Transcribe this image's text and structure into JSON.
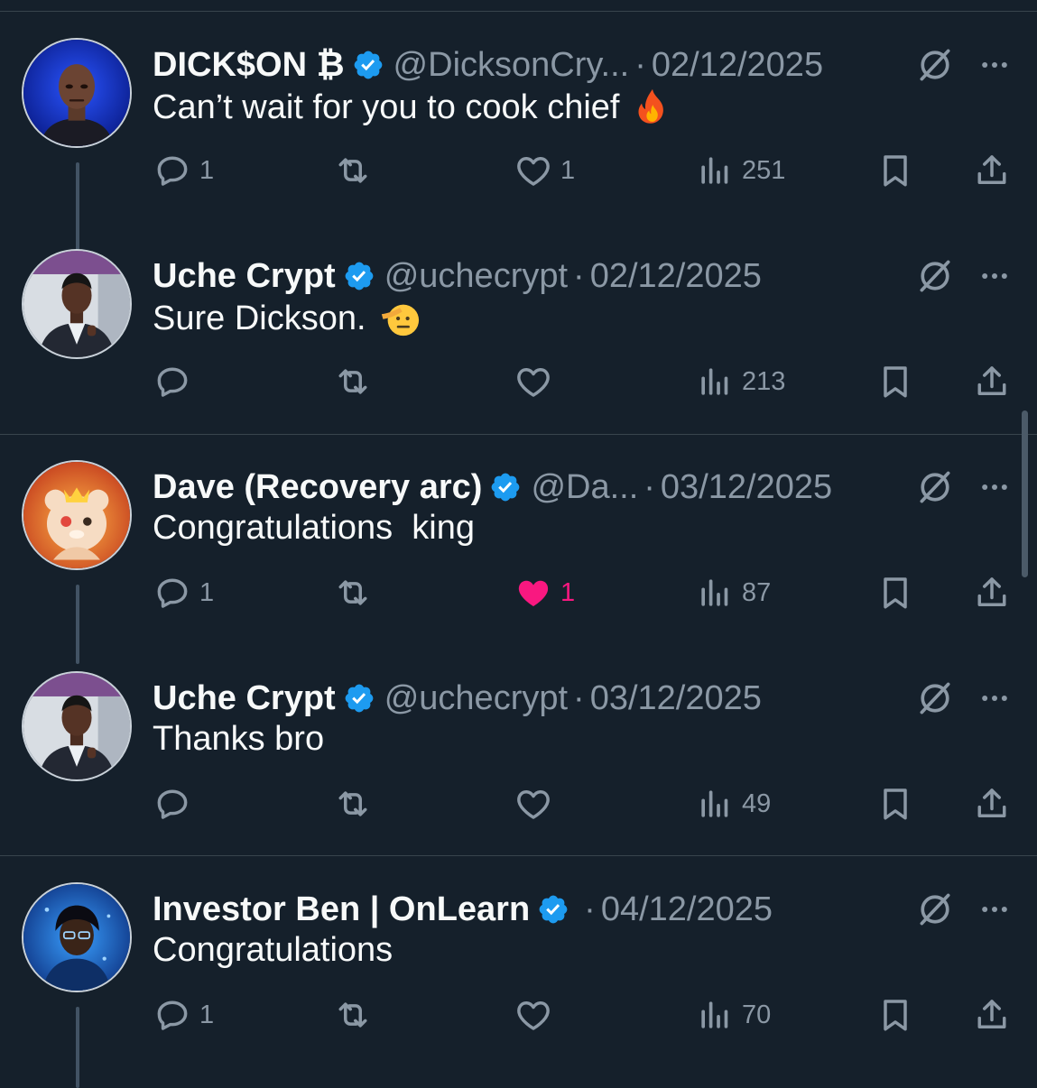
{
  "colors": {
    "background": "#15202b",
    "text": "#f7f9f9",
    "muted": "#8b98a5",
    "verified": "#1d9bf0",
    "liked": "#f91880",
    "divider": "#38444d"
  },
  "icons": {
    "reply": "reply-icon",
    "repost": "repost-icon",
    "like": "heart-icon",
    "views": "views-icon",
    "bookmark": "bookmark-icon",
    "share": "share-icon",
    "grok": "grok-icon",
    "more": "more-icon",
    "verified": "verified-badge-icon"
  },
  "tweets": [
    {
      "name": "DICK$ON ₿",
      "handle": "@DicksonCry...",
      "date": "02/12/2025",
      "text": "Can’t wait for you to cook chief",
      "emoji": "fire",
      "replies": "1",
      "reposts": "",
      "likes": "1",
      "liked": false,
      "views": "251",
      "avatar": "dickson"
    },
    {
      "name": "Uche Crypt",
      "handle": "@uchecrypt",
      "date": "02/12/2025",
      "text": "Sure Dickson.",
      "emoji": "saluting-face",
      "replies": "",
      "reposts": "",
      "likes": "",
      "liked": false,
      "views": "213",
      "avatar": "uche"
    },
    {
      "name": "Dave (Recovery arc)",
      "handle": "@Da...",
      "date": "03/12/2025",
      "text": "Congratulations  king",
      "emoji": "",
      "replies": "1",
      "reposts": "",
      "likes": "1",
      "liked": true,
      "views": "87",
      "avatar": "dave"
    },
    {
      "name": "Uche Crypt",
      "handle": "@uchecrypt",
      "date": "03/12/2025",
      "text": "Thanks bro",
      "emoji": "",
      "replies": "",
      "reposts": "",
      "likes": "",
      "liked": false,
      "views": "49",
      "avatar": "uche"
    },
    {
      "name": "Investor Ben | OnLearn",
      "handle": "",
      "date": "04/12/2025",
      "text": "Congratulations",
      "emoji": "",
      "replies": "1",
      "reposts": "",
      "likes": "",
      "liked": false,
      "views": "70",
      "avatar": "ben"
    }
  ]
}
